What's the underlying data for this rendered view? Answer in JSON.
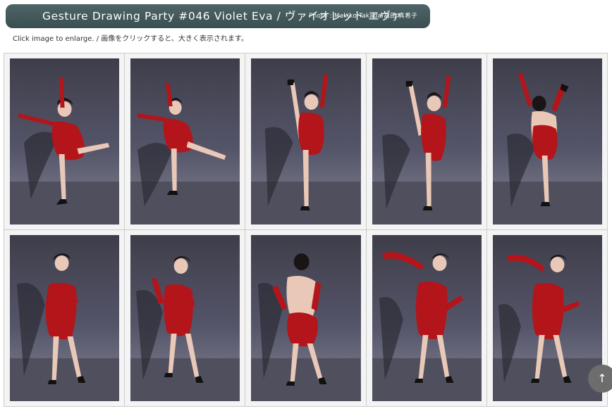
{
  "header": {
    "title": "Gesture Drawing Party #046   Violet Eva / ヴァイオレット エヴァ",
    "credit": "Photo : Makiko Takada/高田 真希子"
  },
  "hint": "Click image to enlarge. / 画像をクリックすると、大きく表示されます。",
  "gallery": {
    "rows": [
      [
        "arabesque-arms-up",
        "arabesque-arms-up",
        "high-kick-front",
        "high-kick-front",
        "high-kick-back"
      ],
      [
        "standing-hands-hips",
        "standing-hands-hips",
        "standing-back-view",
        "stretching-arms-scarf",
        "stretching-arms-scarf"
      ]
    ]
  },
  "back_to_top": {
    "icon": "arrow-up-icon",
    "glyph": "↑"
  },
  "colors": {
    "header_bg": "#3f5558",
    "costume_red": "#b3151b",
    "backdrop": "#505061"
  }
}
